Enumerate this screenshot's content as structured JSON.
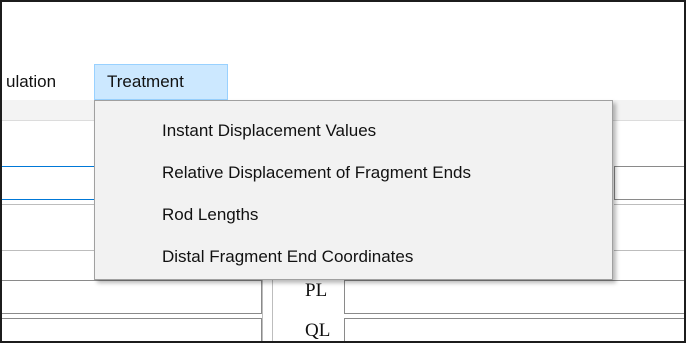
{
  "menubar": {
    "items": [
      {
        "label": "ulation"
      },
      {
        "label": "Treatment"
      }
    ]
  },
  "treatment_menu": {
    "items": [
      {
        "label": "Instant Displacement Values"
      },
      {
        "label": "Relative Displacement of Fragment Ends"
      },
      {
        "label": "Rod Lengths"
      },
      {
        "label": "Distal Fragment End Coordinates"
      }
    ]
  },
  "form": {
    "label_pl": "PL",
    "label_ql": "QL"
  },
  "colors": {
    "menu_highlight": "#cce8ff",
    "menu_highlight_border": "#99d1ff",
    "focus_border": "#0078d7",
    "dropdown_bg": "#f2f2f2"
  }
}
